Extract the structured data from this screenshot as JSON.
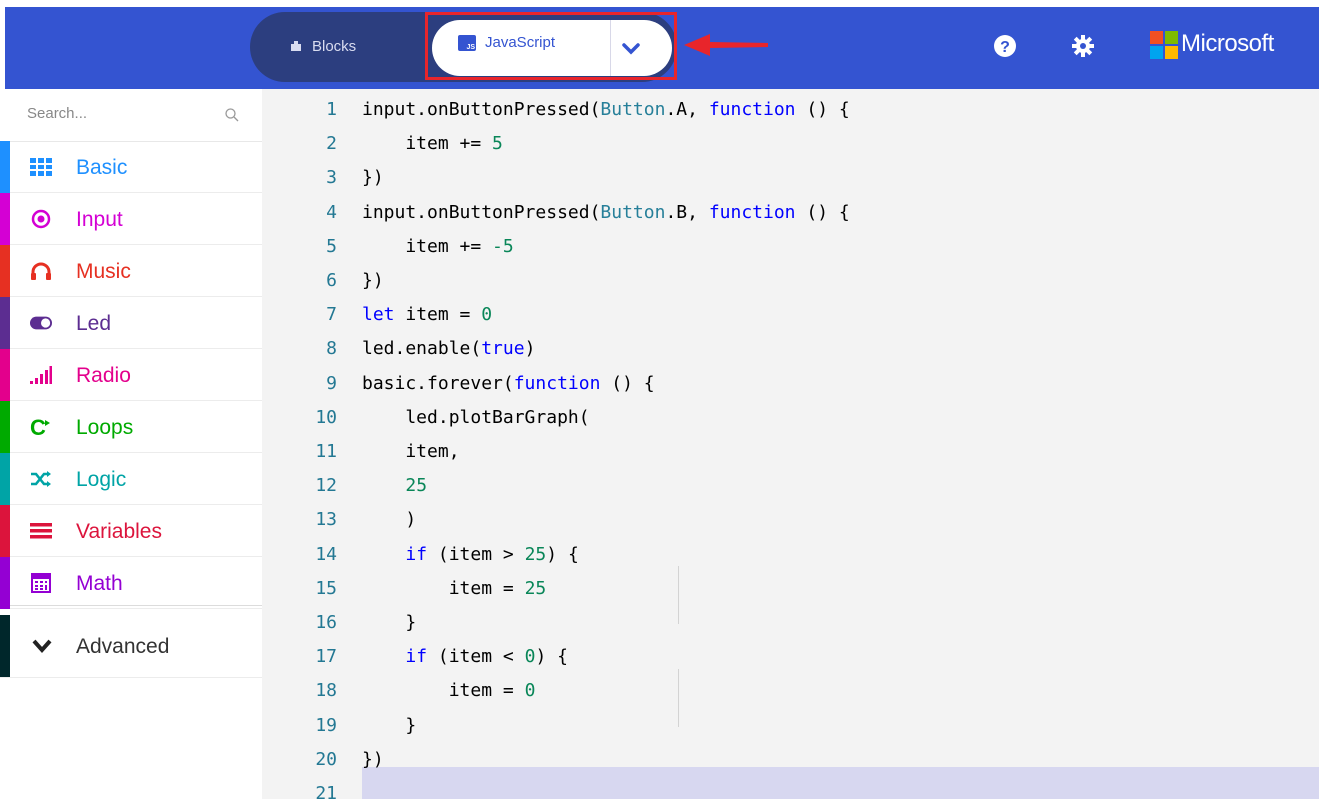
{
  "header": {
    "tabs": {
      "blocks_label": "Blocks",
      "javascript_label": "JavaScript"
    },
    "brand": "Microsoft",
    "colors": {
      "bar": "#3454d1",
      "toggle": "#2c3e7f",
      "highlight": "#e8252b"
    }
  },
  "sidebar": {
    "search_placeholder": "Search...",
    "categories": [
      {
        "label": "Basic",
        "color": "#1e90ff",
        "icon": "grid-icon"
      },
      {
        "label": "Input",
        "color": "#d400d4",
        "icon": "target-icon"
      },
      {
        "label": "Music",
        "color": "#e63022",
        "icon": "headphones-icon"
      },
      {
        "label": "Led",
        "color": "#5c2d91",
        "icon": "toggle-icon"
      },
      {
        "label": "Radio",
        "color": "#e3008c",
        "icon": "signal-bars-icon"
      },
      {
        "label": "Loops",
        "color": "#00aa00",
        "icon": "loop-icon"
      },
      {
        "label": "Logic",
        "color": "#00a4a6",
        "icon": "shuffle-icon"
      },
      {
        "label": "Variables",
        "color": "#dc143c",
        "icon": "list-icon"
      },
      {
        "label": "Math",
        "color": "#9400d3",
        "icon": "calculator-icon"
      }
    ],
    "advanced_label": "Advanced"
  },
  "editor": {
    "lines": [
      {
        "n": "1"
      },
      {
        "n": "2"
      },
      {
        "n": "3"
      },
      {
        "n": "4"
      },
      {
        "n": "5"
      },
      {
        "n": "6"
      },
      {
        "n": "7"
      },
      {
        "n": "8"
      },
      {
        "n": "9"
      },
      {
        "n": "10"
      },
      {
        "n": "11"
      },
      {
        "n": "12"
      },
      {
        "n": "13"
      },
      {
        "n": "14"
      },
      {
        "n": "15"
      },
      {
        "n": "16"
      },
      {
        "n": "17"
      },
      {
        "n": "18"
      },
      {
        "n": "19"
      },
      {
        "n": "20"
      },
      {
        "n": "21"
      }
    ],
    "code": {
      "l1": [
        [
          "input.onButtonPressed(",
          ""
        ],
        [
          "Button",
          "ty"
        ],
        [
          ".A, ",
          ""
        ],
        [
          "function",
          "kw"
        ],
        [
          " () {",
          ""
        ]
      ],
      "l2": [
        [
          "    item += ",
          ""
        ],
        [
          "5",
          "num"
        ]
      ],
      "l3": [
        [
          "})",
          ""
        ]
      ],
      "l4": [
        [
          "input.onButtonPressed(",
          ""
        ],
        [
          "Button",
          "ty"
        ],
        [
          ".B, ",
          ""
        ],
        [
          "function",
          "kw"
        ],
        [
          " () {",
          ""
        ]
      ],
      "l5": [
        [
          "    item += ",
          ""
        ],
        [
          "-5",
          "num"
        ]
      ],
      "l6": [
        [
          "})",
          ""
        ]
      ],
      "l7": [
        [
          "let",
          "kw"
        ],
        [
          " item = ",
          ""
        ],
        [
          "0",
          "num"
        ]
      ],
      "l8": [
        [
          "led.enable(",
          ""
        ],
        [
          "true",
          "kw"
        ],
        [
          ")",
          ""
        ]
      ],
      "l9": [
        [
          "basic.forever(",
          ""
        ],
        [
          "function",
          "kw"
        ],
        [
          " () {",
          ""
        ]
      ],
      "l10": [
        [
          "    led.plotBarGraph(",
          ""
        ]
      ],
      "l11": [
        [
          "    item,",
          ""
        ]
      ],
      "l12": [
        [
          "    ",
          ""
        ],
        [
          "25",
          "num"
        ]
      ],
      "l13": [
        [
          "    )",
          ""
        ]
      ],
      "l14": [
        [
          "    ",
          ""
        ],
        [
          "if",
          "kw"
        ],
        [
          " (item > ",
          ""
        ],
        [
          "25",
          "num"
        ],
        [
          ") {",
          ""
        ]
      ],
      "l15": [
        [
          "        item = ",
          ""
        ],
        [
          "25",
          "num"
        ]
      ],
      "l16": [
        [
          "    }",
          ""
        ]
      ],
      "l17": [
        [
          "    ",
          ""
        ],
        [
          "if",
          "kw"
        ],
        [
          " (item < ",
          ""
        ],
        [
          "0",
          "num"
        ],
        [
          ") {",
          ""
        ]
      ],
      "l18": [
        [
          "        item = ",
          ""
        ],
        [
          "0",
          "num"
        ]
      ],
      "l19": [
        [
          "    }",
          ""
        ]
      ],
      "l20": [
        [
          "})",
          ""
        ]
      ],
      "l21": [
        [
          "",
          ""
        ]
      ]
    }
  }
}
